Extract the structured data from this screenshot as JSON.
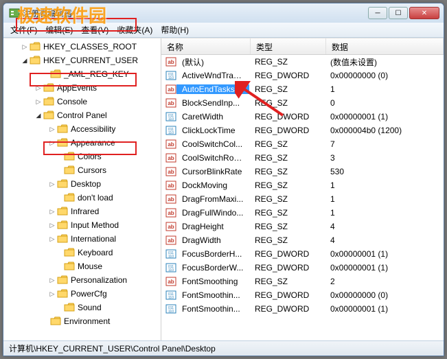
{
  "window": {
    "title": "注册表编辑器",
    "watermark": "极速软件园"
  },
  "winbuttons": {
    "min": "─",
    "max": "☐",
    "close": "✕"
  },
  "menu": {
    "file": "文件(F)",
    "edit": "编辑(E)",
    "view": "查看(V)",
    "favorites": "收藏夹(A)",
    "help": "帮助(H)"
  },
  "tree": [
    {
      "label": "HKEY_CLASSES_ROOT",
      "indent": 24,
      "arrow": "▷",
      "highlight": false
    },
    {
      "label": "HKEY_CURRENT_USER",
      "indent": 24,
      "arrow": "◢",
      "highlight": true
    },
    {
      "label": "_AML_REG_KEY",
      "indent": 54,
      "arrow": "",
      "highlight": false
    },
    {
      "label": "AppEvents",
      "indent": 44,
      "arrow": "▷",
      "highlight": false
    },
    {
      "label": "Console",
      "indent": 44,
      "arrow": "▷",
      "highlight": false
    },
    {
      "label": "Control Panel",
      "indent": 44,
      "arrow": "◢",
      "highlight": true
    },
    {
      "label": "Accessibility",
      "indent": 64,
      "arrow": "▷",
      "highlight": false
    },
    {
      "label": "Appearance",
      "indent": 64,
      "arrow": "▷",
      "highlight": false
    },
    {
      "label": "Colors",
      "indent": 74,
      "arrow": "",
      "highlight": false
    },
    {
      "label": "Cursors",
      "indent": 74,
      "arrow": "",
      "highlight": false
    },
    {
      "label": "Desktop",
      "indent": 64,
      "arrow": "▷",
      "highlight": true
    },
    {
      "label": "don't load",
      "indent": 74,
      "arrow": "",
      "highlight": false
    },
    {
      "label": "Infrared",
      "indent": 64,
      "arrow": "▷",
      "highlight": false
    },
    {
      "label": "Input Method",
      "indent": 64,
      "arrow": "▷",
      "highlight": false
    },
    {
      "label": "International",
      "indent": 64,
      "arrow": "▷",
      "highlight": false
    },
    {
      "label": "Keyboard",
      "indent": 74,
      "arrow": "",
      "highlight": false
    },
    {
      "label": "Mouse",
      "indent": 74,
      "arrow": "",
      "highlight": false
    },
    {
      "label": "Personalization",
      "indent": 64,
      "arrow": "▷",
      "highlight": false
    },
    {
      "label": "PowerCfg",
      "indent": 64,
      "arrow": "▷",
      "highlight": false
    },
    {
      "label": "Sound",
      "indent": 74,
      "arrow": "",
      "highlight": false
    },
    {
      "label": "Environment",
      "indent": 54,
      "arrow": "",
      "highlight": false
    }
  ],
  "list_header": {
    "name": "名称",
    "type": "类型",
    "data": "数据"
  },
  "list": [
    {
      "icon": "sz",
      "name": "(默认)",
      "type": "REG_SZ",
      "data": "(数值未设置)",
      "sel": false
    },
    {
      "icon": "dw",
      "name": "ActiveWndTrac...",
      "type": "REG_DWORD",
      "data": "0x00000000 (0)",
      "sel": false
    },
    {
      "icon": "sz",
      "name": "AutoEndTasks",
      "type": "REG_SZ",
      "data": "1",
      "sel": true
    },
    {
      "icon": "sz",
      "name": "BlockSendInp...",
      "type": "REG_SZ",
      "data": "0",
      "sel": false
    },
    {
      "icon": "dw",
      "name": "CaretWidth",
      "type": "REG_DWORD",
      "data": "0x00000001 (1)",
      "sel": false
    },
    {
      "icon": "dw",
      "name": "ClickLockTime",
      "type": "REG_DWORD",
      "data": "0x000004b0 (1200)",
      "sel": false
    },
    {
      "icon": "sz",
      "name": "CoolSwitchCol...",
      "type": "REG_SZ",
      "data": "7",
      "sel": false
    },
    {
      "icon": "sz",
      "name": "CoolSwitchRows",
      "type": "REG_SZ",
      "data": "3",
      "sel": false
    },
    {
      "icon": "sz",
      "name": "CursorBlinkRate",
      "type": "REG_SZ",
      "data": "530",
      "sel": false
    },
    {
      "icon": "sz",
      "name": "DockMoving",
      "type": "REG_SZ",
      "data": "1",
      "sel": false
    },
    {
      "icon": "sz",
      "name": "DragFromMaxi...",
      "type": "REG_SZ",
      "data": "1",
      "sel": false
    },
    {
      "icon": "sz",
      "name": "DragFullWindo...",
      "type": "REG_SZ",
      "data": "1",
      "sel": false
    },
    {
      "icon": "sz",
      "name": "DragHeight",
      "type": "REG_SZ",
      "data": "4",
      "sel": false
    },
    {
      "icon": "sz",
      "name": "DragWidth",
      "type": "REG_SZ",
      "data": "4",
      "sel": false
    },
    {
      "icon": "dw",
      "name": "FocusBorderH...",
      "type": "REG_DWORD",
      "data": "0x00000001 (1)",
      "sel": false
    },
    {
      "icon": "dw",
      "name": "FocusBorderW...",
      "type": "REG_DWORD",
      "data": "0x00000001 (1)",
      "sel": false
    },
    {
      "icon": "sz",
      "name": "FontSmoothing",
      "type": "REG_SZ",
      "data": "2",
      "sel": false
    },
    {
      "icon": "dw",
      "name": "FontSmoothin...",
      "type": "REG_DWORD",
      "data": "0x00000000 (0)",
      "sel": false
    },
    {
      "icon": "dw",
      "name": "FontSmoothin...",
      "type": "REG_DWORD",
      "data": "0x00000001 (1)",
      "sel": false
    }
  ],
  "statusbar": {
    "path": "计算机\\HKEY_CURRENT_USER\\Control Panel\\Desktop"
  }
}
